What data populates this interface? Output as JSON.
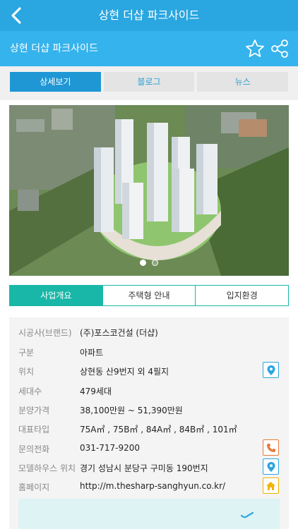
{
  "header": {
    "title": "상현 더샵 파크사이드"
  },
  "subheader": {
    "name": "상현 더샵 파크사이드"
  },
  "tabs": [
    {
      "label": "상세보기",
      "active": true
    },
    {
      "label": "블로그",
      "active": false
    },
    {
      "label": "뉴스",
      "active": false
    }
  ],
  "carousel": {
    "count": 2,
    "current": 0
  },
  "segments": [
    {
      "label": "사업개요",
      "active": true
    },
    {
      "label": "주택형 안내",
      "active": false
    },
    {
      "label": "입지환경",
      "active": false
    }
  ],
  "details": [
    {
      "key": "시공사(브랜드)",
      "value": "(주)포스코건설 (더샵)",
      "icon": ""
    },
    {
      "key": "구분",
      "value": "아파트",
      "icon": ""
    },
    {
      "key": "위치",
      "value": "상현동 산9번지 외 4필지",
      "icon": "map-pin-icon"
    },
    {
      "key": "세대수",
      "value": "479세대",
      "icon": ""
    },
    {
      "key": "분양가격",
      "value": "38,100만원 ~ 51,390만원",
      "icon": ""
    },
    {
      "key": "대표타입",
      "value": "75A㎡ , 75B㎡ , 84A㎡ , 84B㎡ , 101㎡",
      "icon": ""
    },
    {
      "key": "문의전화",
      "value": "031-717-9200",
      "icon": "phone-icon"
    },
    {
      "key": "모델하우스 위치",
      "value": "경기 성남시 분당구 구미동 190번지",
      "icon": "map-pin-icon"
    },
    {
      "key": "홈페이지",
      "value": "http://m.thesharp-sanghyun.co.kr/",
      "icon": "home-icon"
    }
  ],
  "colors": {
    "primary": "#2aa6e0",
    "teal": "#19b7a8",
    "phone": "#e87a3a",
    "home": "#f1b400"
  }
}
